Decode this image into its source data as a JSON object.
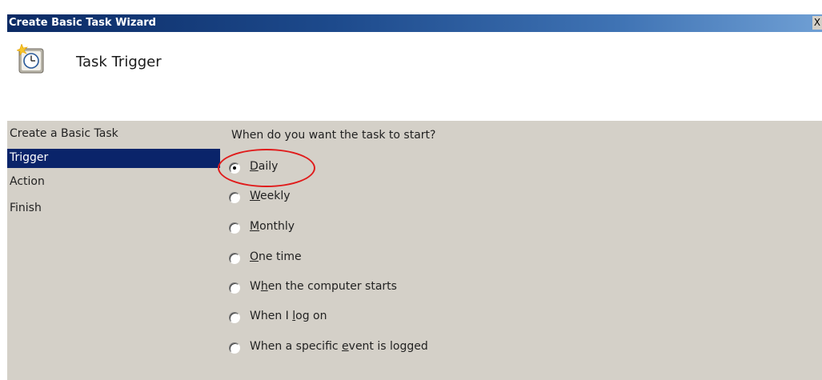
{
  "window": {
    "title": "Create Basic Task Wizard",
    "close_label": "X"
  },
  "header": {
    "icon": "clock-icon",
    "title": "Task Trigger"
  },
  "nav": {
    "items": [
      {
        "label": "Create a Basic Task",
        "selected": false
      },
      {
        "label": "Trigger",
        "selected": true
      },
      {
        "label": "Action",
        "selected": false
      },
      {
        "label": "Finish",
        "selected": false
      }
    ]
  },
  "main": {
    "question": "When do you want the task to start?",
    "options": [
      {
        "pre": "",
        "key": "D",
        "post": "aily",
        "checked": true
      },
      {
        "pre": "",
        "key": "W",
        "post": "eekly",
        "checked": false
      },
      {
        "pre": "",
        "key": "M",
        "post": "onthly",
        "checked": false
      },
      {
        "pre": "",
        "key": "O",
        "post": "ne time",
        "checked": false
      },
      {
        "pre": "W",
        "key": "h",
        "post": "en the computer starts",
        "checked": false
      },
      {
        "pre": "When I ",
        "key": "l",
        "post": "og on",
        "checked": false
      },
      {
        "pre": "When a specific ",
        "key": "e",
        "post": "vent is logged",
        "checked": false
      }
    ]
  },
  "annotation": {
    "color": "#e01b1b"
  }
}
